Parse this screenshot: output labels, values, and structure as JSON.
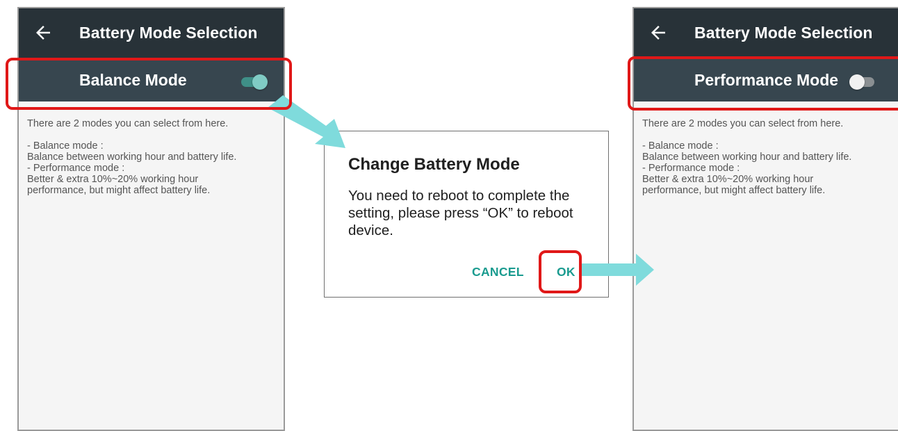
{
  "left_screen": {
    "appbar": {
      "back_icon": "arrow-left-icon",
      "title": "Battery Mode Selection"
    },
    "mode": {
      "label": "Balance Mode",
      "toggle_on": true
    },
    "description": {
      "intro": "There are 2 modes you can select from here.",
      "lines": [
        "- Balance mode :",
        "Balance between working hour and battery life.",
        "- Performance mode :",
        "Better & extra 10%~20% working hour performance, but might affect battery life."
      ]
    }
  },
  "dialog": {
    "title": "Change Battery Mode",
    "message": "You need to reboot to complete the setting, please press “OK” to reboot device.",
    "cancel_label": "CANCEL",
    "ok_label": "OK"
  },
  "right_screen": {
    "appbar": {
      "back_icon": "arrow-left-icon",
      "title": "Battery Mode Selection"
    },
    "mode": {
      "label": "Performance Mode",
      "toggle_on": false
    },
    "description": {
      "intro": "There are 2 modes you can select from here.",
      "lines": [
        "- Balance mode :",
        "Balance between working hour and battery life.",
        "- Performance mode :",
        "Better & extra 10%~20% working hour performance, but might affect battery life."
      ]
    }
  },
  "colors": {
    "appbar": "#283238",
    "mode_row": "#37464f",
    "accent": "#1a9b8f",
    "highlight": "#e01818",
    "arrow": "#7fdbdc"
  }
}
